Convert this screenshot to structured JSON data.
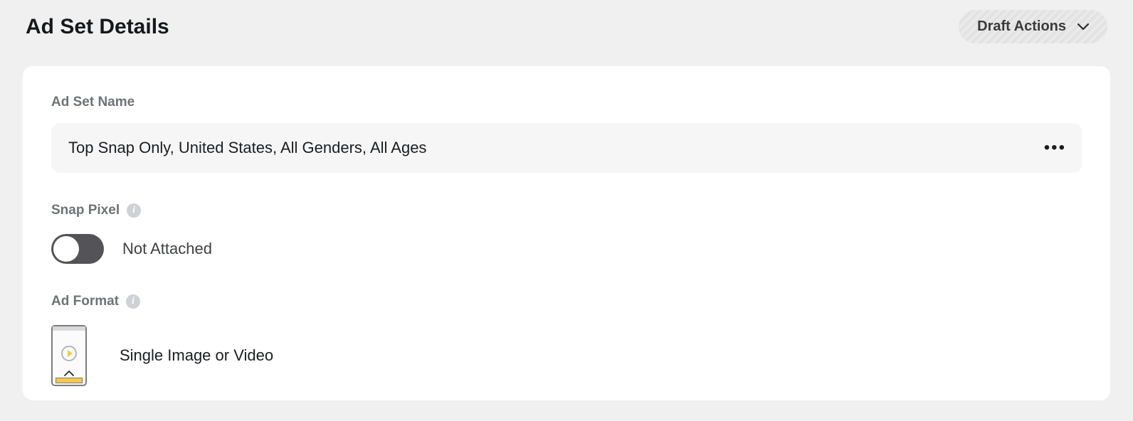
{
  "header": {
    "title": "Ad Set Details",
    "draft_actions_label": "Draft Actions"
  },
  "ad_set_name": {
    "label": "Ad Set Name",
    "value": "Top Snap Only, United States, All Genders, All Ages"
  },
  "snap_pixel": {
    "label": "Snap Pixel",
    "status": "Not Attached",
    "enabled": false
  },
  "ad_format": {
    "label": "Ad Format",
    "value": "Single Image or Video"
  }
}
